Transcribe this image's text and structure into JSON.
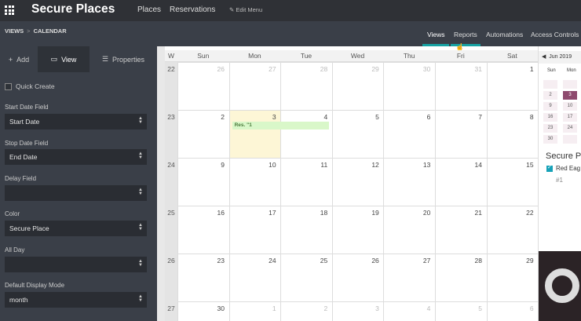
{
  "app": {
    "title": "Secure Places"
  },
  "topnav": {
    "places": "Places",
    "reservations": "Reservations",
    "edit_menu": "✎ Edit Menu"
  },
  "breadcrumb": {
    "views": "VIEWS",
    "separator": ">",
    "current": "CALENDAR"
  },
  "view_tabs": [
    {
      "label": "Views",
      "active": true
    },
    {
      "label": "Reports",
      "active": false
    },
    {
      "label": "Automations",
      "active": false
    },
    {
      "label": "Access Controls",
      "active": false
    }
  ],
  "sidebar": {
    "tabs": [
      {
        "icon": "plus-icon",
        "label": "Add"
      },
      {
        "icon": "monitor-icon",
        "label": "View"
      },
      {
        "icon": "list-icon",
        "label": "Properties"
      }
    ],
    "quick_create": "Quick Create",
    "fields": [
      {
        "label": "Start Date Field",
        "value": "Start Date"
      },
      {
        "label": "Stop Date Field",
        "value": "End Date"
      },
      {
        "label": "Delay Field",
        "value": ""
      },
      {
        "label": "Color",
        "value": "Secure Place"
      },
      {
        "label": "All Day",
        "value": ""
      },
      {
        "label": "Default Display Mode",
        "value": "month"
      }
    ]
  },
  "calendar": {
    "week_header": "W",
    "days": [
      "Sun",
      "Mon",
      "Tue",
      "Wed",
      "Thu",
      "Fri",
      "Sat"
    ],
    "weeks": [
      {
        "num": "22",
        "dates": [
          "26",
          "27",
          "28",
          "29",
          "30",
          "31",
          "1"
        ]
      },
      {
        "num": "23",
        "dates": [
          "2",
          "3",
          "4",
          "5",
          "6",
          "7",
          "8"
        ]
      },
      {
        "num": "24",
        "dates": [
          "9",
          "10",
          "11",
          "12",
          "13",
          "14",
          "15"
        ]
      },
      {
        "num": "25",
        "dates": [
          "16",
          "17",
          "18",
          "19",
          "20",
          "21",
          "22"
        ]
      },
      {
        "num": "26",
        "dates": [
          "23",
          "24",
          "25",
          "26",
          "27",
          "28",
          "29"
        ]
      },
      {
        "num": "27",
        "dates": [
          "30",
          "1",
          "2",
          "3",
          "4",
          "5",
          "6"
        ]
      }
    ],
    "event": {
      "label": "Res. \"1"
    },
    "colors": {
      "today": "#fdf6d6",
      "event_bg": "#d9f7c9",
      "accent": "#17a2a2"
    }
  },
  "mini_calendar": {
    "header": "Jun 2019",
    "dow": [
      "Sun",
      "Mon"
    ],
    "rows": [
      [
        "",
        ""
      ],
      [
        "2",
        "3"
      ],
      [
        "9",
        "10"
      ],
      [
        "16",
        "17"
      ],
      [
        "23",
        "24"
      ],
      [
        "30",
        ""
      ]
    ]
  },
  "right_panel": {
    "title": "Secure P",
    "item": "Red Eag",
    "sub": "#1"
  }
}
